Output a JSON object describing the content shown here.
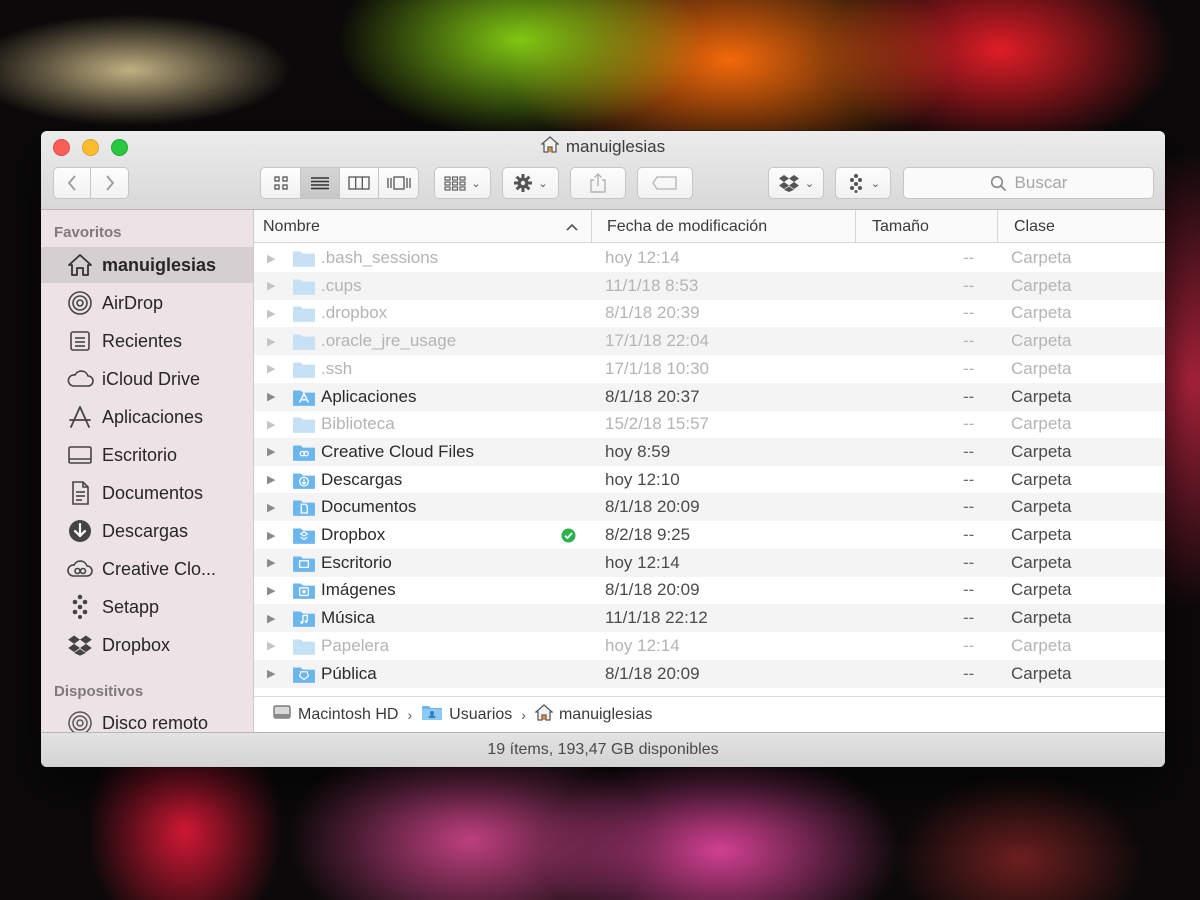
{
  "window": {
    "title": "manuiglesias",
    "title_icon": "home-icon"
  },
  "toolbar": {
    "back_icon": "chevron-left-icon",
    "forward_icon": "chevron-right-icon",
    "views": [
      {
        "name": "icon-view",
        "icon": "grid-icon",
        "active": false
      },
      {
        "name": "list-view",
        "icon": "list-icon",
        "active": true
      },
      {
        "name": "column-view",
        "icon": "columns-icon",
        "active": false
      },
      {
        "name": "coverflow-view",
        "icon": "coverflow-icon",
        "active": false
      }
    ],
    "search_placeholder": "Buscar"
  },
  "sidebar": {
    "favorites_header": "Favoritos",
    "devices_header": "Dispositivos",
    "favorites": [
      {
        "label": "manuiglesias",
        "icon": "home-icon",
        "selected": true
      },
      {
        "label": "AirDrop",
        "icon": "airdrop-icon",
        "selected": false
      },
      {
        "label": "Recientes",
        "icon": "recents-icon",
        "selected": false
      },
      {
        "label": "iCloud Drive",
        "icon": "cloud-icon",
        "selected": false
      },
      {
        "label": "Aplicaciones",
        "icon": "applications-icon",
        "selected": false
      },
      {
        "label": "Escritorio",
        "icon": "desktop-icon",
        "selected": false
      },
      {
        "label": "Documentos",
        "icon": "document-icon",
        "selected": false
      },
      {
        "label": "Descargas",
        "icon": "download-icon",
        "selected": false
      },
      {
        "label": "Creative Clo...",
        "icon": "creative-cloud-icon",
        "selected": false
      },
      {
        "label": "Setapp",
        "icon": "setapp-icon",
        "selected": false
      },
      {
        "label": "Dropbox",
        "icon": "dropbox-icon",
        "selected": false
      }
    ],
    "devices": [
      {
        "label": "Disco remoto",
        "icon": "disc-icon"
      }
    ]
  },
  "columns": {
    "name": "Nombre",
    "sort_indicator": "^",
    "date": "Fecha de modificación",
    "size": "Tamaño",
    "kind": "Clase"
  },
  "files": [
    {
      "name": ".bash_sessions",
      "date": "hoy 12:14",
      "size": "--",
      "kind": "Carpeta",
      "dim": true,
      "icon": "folder-icon"
    },
    {
      "name": ".cups",
      "date": "11/1/18 8:53",
      "size": "--",
      "kind": "Carpeta",
      "dim": true,
      "icon": "folder-icon"
    },
    {
      "name": ".dropbox",
      "date": "8/1/18 20:39",
      "size": "--",
      "kind": "Carpeta",
      "dim": true,
      "icon": "folder-icon"
    },
    {
      "name": ".oracle_jre_usage",
      "date": "17/1/18 22:04",
      "size": "--",
      "kind": "Carpeta",
      "dim": true,
      "icon": "folder-icon"
    },
    {
      "name": ".ssh",
      "date": "17/1/18 10:30",
      "size": "--",
      "kind": "Carpeta",
      "dim": true,
      "icon": "folder-icon"
    },
    {
      "name": "Aplicaciones",
      "date": "8/1/18 20:37",
      "size": "--",
      "kind": "Carpeta",
      "dim": false,
      "icon": "applications-folder-icon"
    },
    {
      "name": "Biblioteca",
      "date": "15/2/18 15:57",
      "size": "--",
      "kind": "Carpeta",
      "dim": true,
      "icon": "library-folder-icon"
    },
    {
      "name": "Creative Cloud Files",
      "date": "hoy 8:59",
      "size": "--",
      "kind": "Carpeta",
      "dim": false,
      "icon": "creative-cloud-folder-icon"
    },
    {
      "name": "Descargas",
      "date": "hoy 12:10",
      "size": "--",
      "kind": "Carpeta",
      "dim": false,
      "icon": "downloads-folder-icon"
    },
    {
      "name": "Documentos",
      "date": "8/1/18 20:09",
      "size": "--",
      "kind": "Carpeta",
      "dim": false,
      "icon": "documents-folder-icon"
    },
    {
      "name": "Dropbox",
      "date": "8/2/18 9:25",
      "size": "--",
      "kind": "Carpeta",
      "dim": false,
      "icon": "dropbox-folder-icon",
      "synced": true
    },
    {
      "name": "Escritorio",
      "date": "hoy 12:14",
      "size": "--",
      "kind": "Carpeta",
      "dim": false,
      "icon": "desktop-folder-icon"
    },
    {
      "name": "Imágenes",
      "date": "8/1/18 20:09",
      "size": "--",
      "kind": "Carpeta",
      "dim": false,
      "icon": "pictures-folder-icon"
    },
    {
      "name": "Música",
      "date": "11/1/18 22:12",
      "size": "--",
      "kind": "Carpeta",
      "dim": false,
      "icon": "music-folder-icon"
    },
    {
      "name": "Papelera",
      "date": "hoy 12:14",
      "size": "--",
      "kind": "Carpeta",
      "dim": true,
      "icon": "folder-icon"
    },
    {
      "name": "Pública",
      "date": "8/1/18 20:09",
      "size": "--",
      "kind": "Carpeta",
      "dim": false,
      "icon": "public-folder-icon"
    }
  ],
  "pathbar": [
    {
      "label": "Macintosh HD",
      "icon": "hard-drive-icon"
    },
    {
      "label": "Usuarios",
      "icon": "users-folder-icon"
    },
    {
      "label": "manuiglesias",
      "icon": "home-icon"
    }
  ],
  "status": "19 ítems, 193,47 GB disponibles",
  "colors": {
    "folder": "#6cb6ee",
    "folder_dim": "#c6e0f5",
    "sync_badge": "#2bb24c",
    "sidebar_selected": "#d5cfd2"
  }
}
